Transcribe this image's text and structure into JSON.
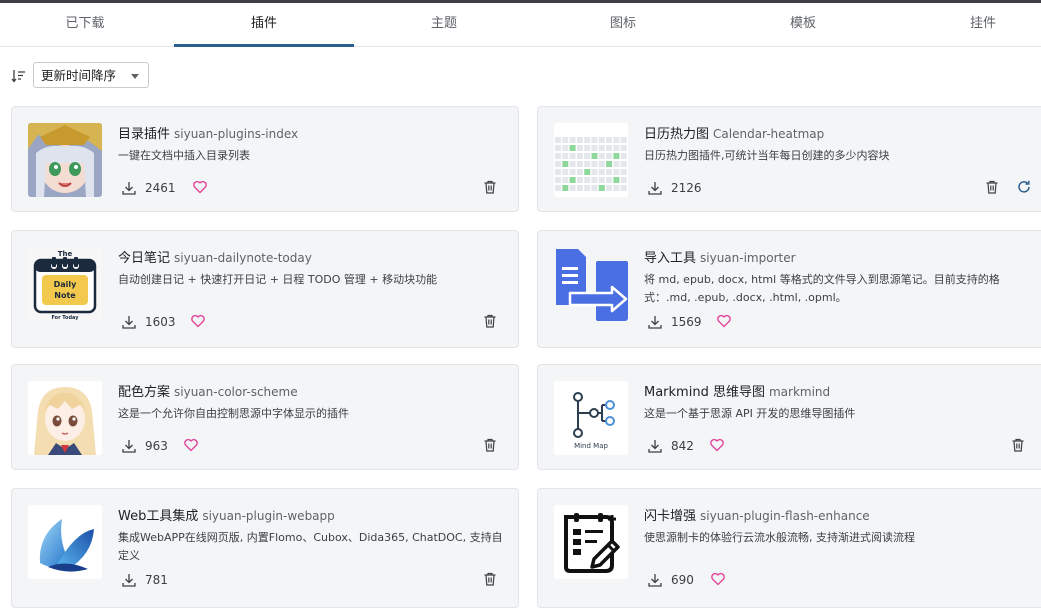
{
  "tabs": [
    {
      "label": "已下载"
    },
    {
      "label": "插件"
    },
    {
      "label": "主题"
    },
    {
      "label": "图标"
    },
    {
      "label": "模板"
    },
    {
      "label": "挂件"
    }
  ],
  "sort": {
    "selected": "更新时间降序"
  },
  "accent_color": "#2a5e8f",
  "heart_color": "#e0459a",
  "cards": [
    {
      "title": "目录插件",
      "package": "siyuan-plugins-index",
      "desc": "一键在文档中插入目录列表",
      "downloads": "2461"
    },
    {
      "title": "日历热力图",
      "package": "Calendar-heatmap",
      "desc": "日历热力图插件,可统计当年每日创建的多少内容块",
      "downloads": "2126"
    },
    {
      "title": "今日笔记",
      "package": "siyuan-dailynote-today",
      "desc": "自动创建日记 + 快速打开日记 + 日程 TODO 管理 + 移动块功能",
      "downloads": "1603"
    },
    {
      "title": "导入工具",
      "package": "siyuan-importer",
      "desc": "将 md, epub, docx, html 等格式的文件导入到思源笔记。目前支持的格式：.md, .epub, .docx, .html, .opml。",
      "downloads": "1569"
    },
    {
      "title": "配色方案",
      "package": "siyuan-color-scheme",
      "desc": "这是一个允许你自由控制思源中字体显示的插件",
      "downloads": "963"
    },
    {
      "title": "Markmind 思维导图",
      "package": "markmind",
      "desc": "这是一个基于思源 API 开发的思维导图插件",
      "downloads": "842"
    },
    {
      "title": "Web工具集成",
      "package": "siyuan-plugin-webapp",
      "desc": "集成WebAPP在线网页版, 内置Flomo、Cubox、Dida365, ChatDOC, 支持自定义",
      "downloads": "781"
    },
    {
      "title": "闪卡增强",
      "package": "siyuan-plugin-flash-enhance",
      "desc": "使思源制卡的体验行云流水般流畅, 支持渐进式阅读流程",
      "downloads": "690"
    }
  ],
  "thumb_text": {
    "daily_note_top": "The",
    "daily_note_line1": "Daily",
    "daily_note_line2": "Note",
    "daily_note_bottom": "For Today",
    "mindmap": "Mind Map"
  }
}
